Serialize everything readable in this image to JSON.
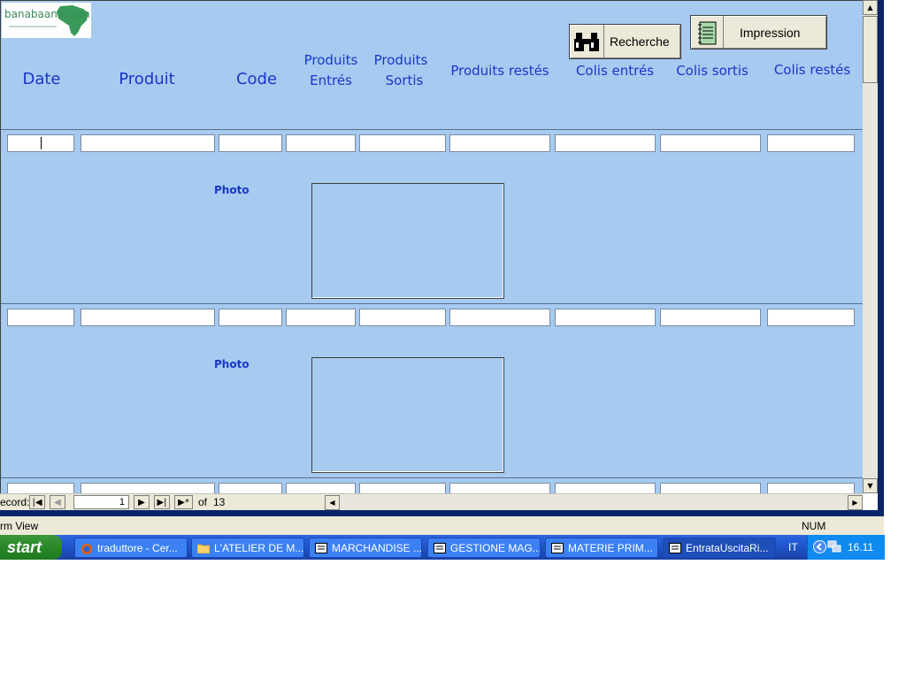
{
  "logo": {
    "text": "banabaana.com"
  },
  "buttons": {
    "search_label": "Recherche",
    "print_label": "Impression"
  },
  "columns": {
    "date": "Date",
    "produit": "Produit",
    "code": "Code",
    "produits_entres_1": "Produits",
    "produits_entres_2": "Entrés",
    "produits_sortis_1": "Produits",
    "produits_sortis_2": "Sortis",
    "produits_restes": "Produits restés",
    "colis_entres": "Colis entrés",
    "colis_sortis": "Colis sortis",
    "colis_restes": "Colis restés"
  },
  "records": [
    {
      "photo_label": "Photo"
    },
    {
      "photo_label": "Photo"
    }
  ],
  "navigation": {
    "record_label": "ecord:",
    "current": "1",
    "of_label": "of",
    "total": "13"
  },
  "status": {
    "left": "rm View",
    "num": "NUM"
  },
  "taskbar": {
    "start": "start",
    "tasks": [
      "traduttore - Cer...",
      "L'ATELIER DE M...",
      "MARCHANDISE ...",
      "GESTIONE MAG...",
      "MATERIE PRIM...",
      "EntrataUscitaRi..."
    ],
    "lang": "IT",
    "clock": "16.11"
  },
  "colors": {
    "form_bg": "#a6caf0",
    "header_text": "#1a36c8",
    "taskbar": "#245edb"
  }
}
